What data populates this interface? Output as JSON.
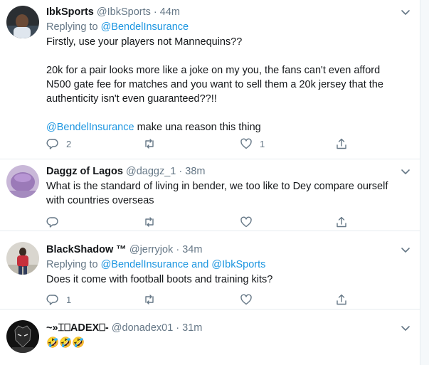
{
  "tweets": [
    {
      "name": "IbkSports",
      "handle": "@IbkSports",
      "dot": "·",
      "time": "44m",
      "replying_prefix": "Replying to ",
      "replying_to": "@BendelInsurance",
      "replying_joiner": "",
      "replying_to_2": "",
      "lines": [
        "Firstly, use your players not Mannequins??",
        "",
        "20k for a pair looks more like a joke on my you, the fans can't even afford",
        "N500 gate fee for matches and you want to sell them a 20k jersey that the",
        "authenticity isn't even guaranteed??!!",
        ""
      ],
      "mention_line_mention": "@BendelInsurance",
      "mention_line_rest": " make una reason this thing",
      "reply_count": "2",
      "retweet_count": "",
      "like_count": "1"
    },
    {
      "name": "Daggz of Lagos",
      "handle": "@daggz_1",
      "dot": "·",
      "time": "38m",
      "lines": [
        "What is the standard of living in bender, we too like to Dey compare ourself",
        "with countries overseas"
      ],
      "reply_count": "",
      "retweet_count": "",
      "like_count": ""
    },
    {
      "name": "BlackShadow ™",
      "handle": "@jerryjok",
      "dot": "·",
      "time": "34m",
      "replying_prefix": "Replying to ",
      "replying_to": "@BendelInsurance",
      "replying_joiner": " and ",
      "replying_to_2": "@IbkSports",
      "lines": [
        "Does it come with football boots and training kits?"
      ],
      "reply_count": "1",
      "retweet_count": "",
      "like_count": ""
    },
    {
      "name": "~»⌶⎕ADEX⎕-",
      "handle": "@donadex01",
      "dot": "·",
      "time": "31m",
      "lines": [
        "🤣🤣🤣"
      ]
    }
  ],
  "icons": {
    "reply": "reply-icon",
    "retweet": "retweet-icon",
    "like": "heart-icon",
    "share": "share-icon",
    "caret": "chevron-down-icon"
  },
  "colors": {
    "link": "#1b95e0",
    "secondary": "#657786",
    "text": "#14171a",
    "divider": "#e6ecf0"
  }
}
